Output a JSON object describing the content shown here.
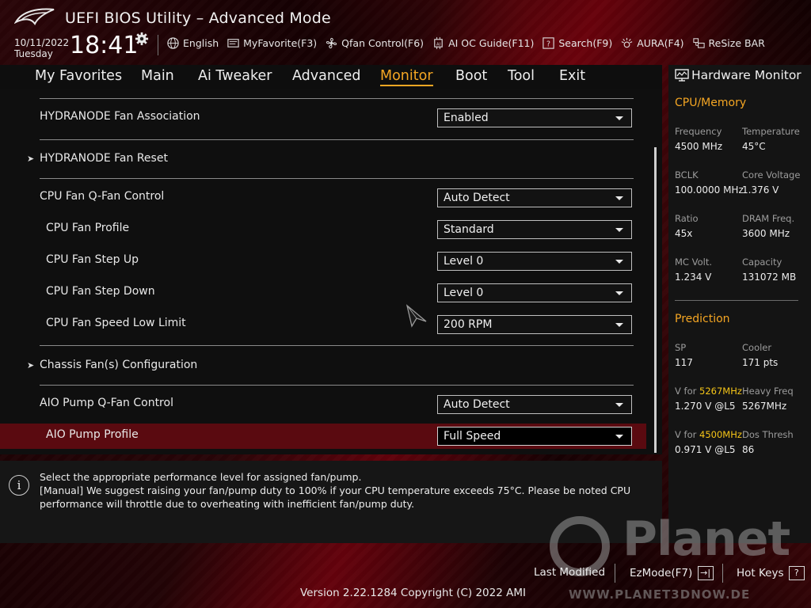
{
  "header": {
    "title": "UEFI BIOS Utility – Advanced Mode",
    "date": "10/11/2022",
    "day": "Tuesday",
    "time": "18:41",
    "toolbar": [
      {
        "label": "English",
        "icon": "globe-icon"
      },
      {
        "label": "MyFavorite(F3)",
        "icon": "favorite-icon"
      },
      {
        "label": "Qfan Control(F6)",
        "icon": "fan-icon"
      },
      {
        "label": "AI OC Guide(F11)",
        "icon": "ai-chip-icon"
      },
      {
        "label": "Search(F9)",
        "icon": "search-icon"
      },
      {
        "label": "AURA(F4)",
        "icon": "aura-icon"
      },
      {
        "label": "ReSize BAR",
        "icon": "resize-bar-icon"
      }
    ]
  },
  "tabs": [
    "My Favorites",
    "Main",
    "Ai Tweaker",
    "Advanced",
    "Monitor",
    "Boot",
    "Tool",
    "Exit"
  ],
  "active_tab": "Monitor",
  "settings": {
    "hydranode_assoc": {
      "label": "HYDRANODE Fan Association",
      "value": "Enabled"
    },
    "hydranode_reset": {
      "label": "HYDRANODE Fan Reset"
    },
    "cpu_qfan": {
      "label": "CPU Fan Q-Fan Control",
      "value": "Auto Detect"
    },
    "cpu_profile": {
      "label": "CPU Fan Profile",
      "value": "Standard"
    },
    "cpu_step_up": {
      "label": "CPU Fan Step Up",
      "value": "Level 0"
    },
    "cpu_step_down": {
      "label": "CPU Fan Step Down",
      "value": "Level 0"
    },
    "cpu_low_limit": {
      "label": "CPU Fan Speed Low Limit",
      "value": "200 RPM"
    },
    "chassis_config": {
      "label": "Chassis Fan(s) Configuration"
    },
    "aio_qfan": {
      "label": "AIO Pump Q-Fan Control",
      "value": "Auto Detect"
    },
    "aio_profile": {
      "label": "AIO Pump Profile",
      "value": "Full Speed"
    }
  },
  "help": {
    "line1": "Select the appropriate performance level for assigned fan/pump.",
    "line2": "[Manual] We suggest raising your fan/pump duty to 100% if your CPU temperature exceeds 75°C. Please be noted CPU performance will throttle due to overheating with inefficient fan/pump duty."
  },
  "hardware_monitor": {
    "title": "Hardware Monitor",
    "cpu_memory": {
      "heading": "CPU/Memory",
      "frequency_label": "Frequency",
      "frequency": "4500 MHz",
      "temperature_label": "Temperature",
      "temperature": "45°C",
      "bclk_label": "BCLK",
      "bclk": "100.0000 MHz",
      "core_voltage_label": "Core Voltage",
      "core_voltage": "1.376 V",
      "ratio_label": "Ratio",
      "ratio": "45x",
      "dram_freq_label": "DRAM Freq.",
      "dram_freq": "3600 MHz",
      "mc_volt_label": "MC Volt.",
      "mc_volt": "1.234 V",
      "capacity_label": "Capacity",
      "capacity": "131072 MB"
    },
    "prediction": {
      "heading": "Prediction",
      "sp_label": "SP",
      "sp": "117",
      "cooler_label": "Cooler",
      "cooler": "171 pts",
      "v_for_prefix": "V for",
      "v_for_freq1": "5267MHz",
      "v_for_val1": "1.270 V @L5",
      "heavy_freq_label": "Heavy Freq",
      "heavy_freq": "5267MHz",
      "v_for_freq2": "4500MHz",
      "v_for_val2": "0.971 V @L5",
      "dos_thresh_label": "Dos Thresh",
      "dos_thresh": "86"
    }
  },
  "footer": {
    "last_modified": "Last Modified",
    "ezmode": "EzMode(F7)",
    "hot_keys": "Hot Keys",
    "hot_keys_key": "?",
    "version": "Version 2.22.1284 Copyright (C) 2022 AMI"
  },
  "watermark": {
    "text": "Planet",
    "sub": "WWW.PLANET3DNOW.DE"
  },
  "colors": {
    "accent": "#f5a623",
    "highlight_row": "#5a0a10",
    "panel": "#0f0f0f"
  }
}
